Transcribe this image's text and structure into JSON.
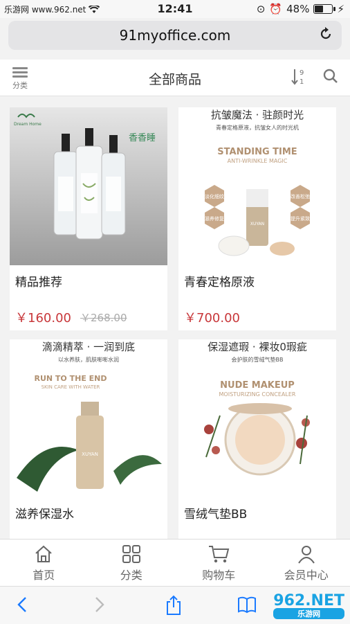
{
  "status": {
    "carrier": "乐游网 www.962.net",
    "time": "12:41",
    "battery": "48%",
    "battery_level": 0.48
  },
  "browser": {
    "url": "91myoffice.com"
  },
  "header": {
    "category_label": "分类",
    "title": "全部商品"
  },
  "products": [
    {
      "name": "精品推荐",
      "price": "￥160.00",
      "old_price": "￥268.00",
      "image": {
        "brand_top": "Dream Home",
        "side_title": "香香睡"
      }
    },
    {
      "name": "青春定格原液",
      "price": "￥700.00",
      "old_price": "",
      "image": {
        "headline": "抗皱魔法 · 驻颜时光",
        "sub": "青春定格原液，抗皱女人的时光机",
        "en1": "STANDING TIME",
        "en2": "ANTI-WRINKLE MAGIC",
        "brand": "XUYAN",
        "badges": [
          "淡化细纹",
          "滋养修复",
          "改善松弛",
          "提升紧致"
        ]
      }
    },
    {
      "name": "滋养保湿水",
      "price": "",
      "old_price": "",
      "image": {
        "headline": "滴滴精萃 · 一润到底",
        "sub": "以水养肤，肌肤嘭嘭水润",
        "en1": "RUN TO THE END",
        "en2": "SKIN CARE WITH WATER",
        "brand": "XUYAN"
      }
    },
    {
      "name": "雪绒气垫BB",
      "price": "",
      "old_price": "",
      "image": {
        "headline": "保湿遮瑕 · 裸妆0瑕疵",
        "sub": "会护肤的雪绒气垫BB",
        "en1": "NUDE MAKEUP",
        "en2": "MOISTURIZING CONCEALER"
      }
    }
  ],
  "tabs": [
    {
      "label": "首页",
      "icon": "home-icon"
    },
    {
      "label": "分类",
      "icon": "grid-icon"
    },
    {
      "label": "购物车",
      "icon": "cart-icon"
    },
    {
      "label": "会员中心",
      "icon": "user-icon"
    }
  ],
  "watermark": {
    "text": "962.NET",
    "sub": "乐游网"
  },
  "colors": {
    "price": "#c8373a",
    "background": "#f2f2f2"
  }
}
